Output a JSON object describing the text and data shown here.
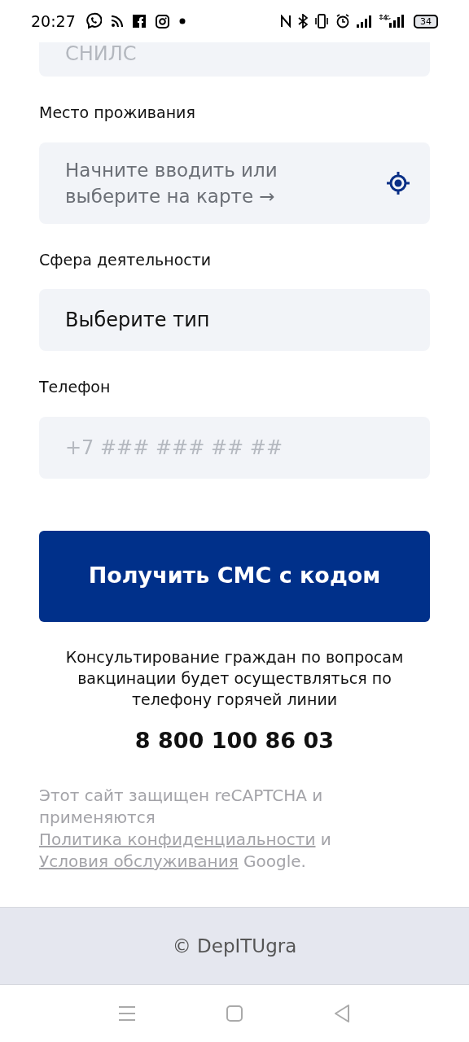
{
  "status_bar": {
    "time": "20:27",
    "battery": "34"
  },
  "fields": [
    {
      "kind": "input",
      "placeholder": "СНИЛС"
    },
    {
      "kind": "address",
      "label": "Место проживания",
      "placeholder": "Начните вводить или выберите на карте →"
    },
    {
      "kind": "select",
      "label": "Сфера деятельности",
      "value": "Выберите тип"
    },
    {
      "kind": "input",
      "label": "Телефон",
      "placeholder": "+7 ### ### ## ##"
    }
  ],
  "submit_button": "Получить СМС с кодом",
  "info": "Консультирование граждан по вопросам вакцинации будет осуществляться по телефону горячей линии",
  "hotline": "8 800 100 86 03",
  "recaptcha": {
    "text": "Этот сайт защищен reCAPTCHA и применяются",
    "privacy_link": "Политика конфиденциальности",
    "and": "и",
    "terms_link": "Условия обслуживания",
    "suffix": "Google."
  },
  "footer": "© DepITUgra"
}
